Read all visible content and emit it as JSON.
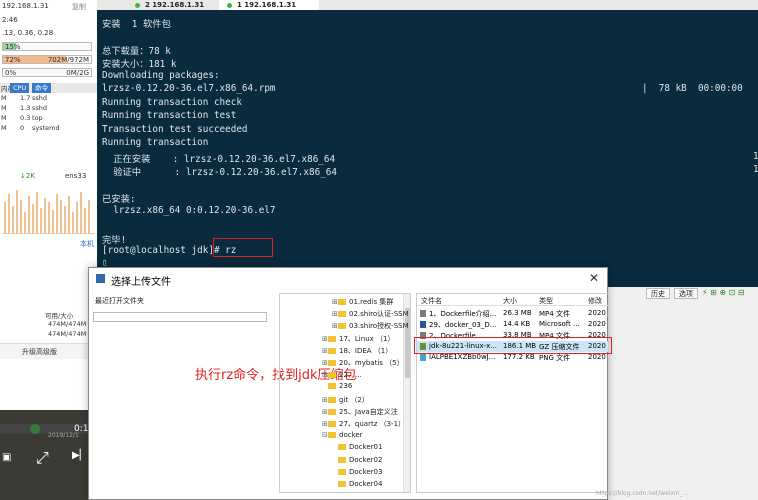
{
  "left_panel": {
    "host": "192.168.1.31",
    "copy": "复制",
    "time": "2:46",
    "load": ".13, 0.36, 0.28",
    "cpu_pct": "15%",
    "mem_pct": "72%",
    "mem_val": "702M/972M",
    "swap_pct": "0%",
    "swap_val": "0M/2G",
    "proc_header": {
      "mem": "内存",
      "cpu": "CPU",
      "cmd": "命令"
    },
    "procs": [
      {
        "mem": "M",
        "cpu": "1.7",
        "cmd": "sshd"
      },
      {
        "mem": "M",
        "cpu": "1.3",
        "cmd": "sshd"
      },
      {
        "mem": "M",
        "cpu": "0.3",
        "cmd": "top"
      },
      {
        "mem": "M",
        "cpu": "0",
        "cmd": "systemd"
      }
    ],
    "net_up": "↓2K",
    "net_if": "ens33",
    "local": "本机",
    "mem_header": "可用/大小",
    "mem_rows": [
      "474M/474M",
      "474M/474M",
      "17G/17G"
    ],
    "advanced": "升级高级版",
    "video_date": "2019/12/1",
    "video_time": "0:1"
  },
  "tabs": [
    {
      "label": "2  192.168.1.31"
    },
    {
      "label": "1  192.168.1.31"
    }
  ],
  "terminal": {
    "lines": [
      "安装  1 软件包",
      "",
      "总下载量：78 k",
      "安装大小：181 k",
      "Downloading packages:",
      "lrzsz-0.12.20-36.el7.x86_64.rpm",
      "Running transaction check",
      "Running transaction test",
      "Transaction test succeeded",
      "Running transaction",
      "  正在安装    : lrzsz-0.12.20-36.el7.x86_64",
      "  验证中      : lrzsz-0.12.20-36.el7.x86_64",
      "",
      "已安装:",
      "  lrzsz.x86_64 0:0.12.20-36.el7",
      "",
      "完毕!",
      "[root@localhost jdk]# rz",
      "▯"
    ],
    "download_stats": "|  78 kB  00:00:00",
    "progress_1": "1",
    "progress_2": "1"
  },
  "term_buttons": {
    "history": "历史",
    "options": "选项"
  },
  "annotation": "执行rz命令，找到jdk压缩包",
  "dialog": {
    "title": "选择上传文件",
    "recent_label": "最近打开文件夹",
    "tree": [
      {
        "label": "01.redis 集群",
        "exp": "⊞",
        "indent": 2
      },
      {
        "label": "02.shiro认证-SSM",
        "exp": "⊞",
        "indent": 2
      },
      {
        "label": "03.shiro授权-SSM",
        "exp": "⊞",
        "indent": 2
      },
      {
        "label": "17、Linux （1）",
        "exp": "⊞",
        "indent": 1
      },
      {
        "label": "18、IDEA （1）",
        "exp": "⊞",
        "indent": 1
      },
      {
        "label": "20、mybatis （5）",
        "exp": "⊞",
        "indent": 1
      },
      {
        "label": "22、...",
        "exp": "⊞",
        "indent": 1
      },
      {
        "label": "236",
        "exp": "",
        "indent": 1
      },
      {
        "label": "git （2）",
        "exp": "⊞",
        "indent": 1
      },
      {
        "label": "25、Java自定义注",
        "exp": "⊞",
        "indent": 1
      },
      {
        "label": "27、quartz （3-1）",
        "exp": "⊞",
        "indent": 1
      },
      {
        "label": "docker",
        "exp": "⊟",
        "indent": 1
      },
      {
        "label": "Docker01",
        "exp": "",
        "indent": 2
      },
      {
        "label": "Docker02",
        "exp": "",
        "indent": 2
      },
      {
        "label": "Docker03",
        "exp": "",
        "indent": 2
      },
      {
        "label": "Docker04",
        "exp": "",
        "indent": 2
      }
    ],
    "file_headers": {
      "name": "文件名",
      "size": "大小",
      "type": "类型",
      "modified": "修改"
    },
    "files": [
      {
        "name": "1、Dockerfile介绍...",
        "size": "26.3 MB",
        "type": "MP4 文件",
        "modified": "2020",
        "icon": "#7a7a7a"
      },
      {
        "name": "29、docker_03_D...",
        "size": "14.4 KB",
        "type": "Microsoft ...",
        "modified": "2020",
        "icon": "#2b579a"
      },
      {
        "name": "2、Dockerfile...",
        "size": "33.8 MB",
        "type": "MP4 文件",
        "modified": "2020",
        "icon": "#7a7a7a"
      },
      {
        "name": "jdk-8u221-linux-x...",
        "size": "186.1 MB",
        "type": "GZ 压缩文件",
        "modified": "2020",
        "icon": "#6a8f3a"
      },
      {
        "name": "IALPBE1XZBb0wJ...",
        "size": "177.2 KB",
        "type": "PNG 文件",
        "modified": "2020",
        "icon": "#4aa0d0"
      }
    ]
  },
  "watermark": "https://blog.csdn.net/weixin_..."
}
